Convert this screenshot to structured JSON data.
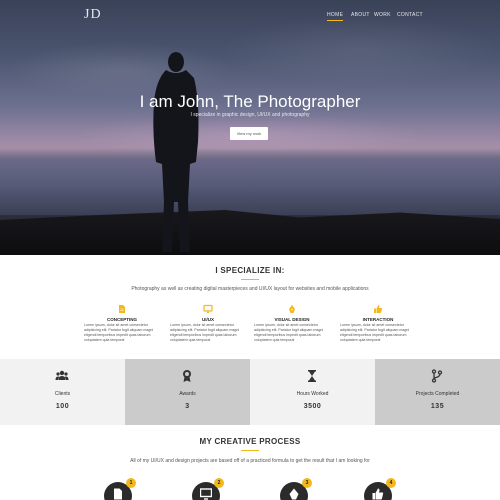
{
  "brand": {
    "logo": "JD"
  },
  "nav": {
    "items": [
      "HOME",
      "ABOUT",
      "WORK",
      "CONTACT"
    ],
    "active": "HOME"
  },
  "hero": {
    "title": "I am John, The Photographer",
    "subtitle": "I specialize in graphic design, UI/UX and photography",
    "button": "View my work"
  },
  "specialize": {
    "title": "I SPECIALIZE IN:",
    "subtitle": "Photography as well as creating digital masterpieces and UI/UX layout for websites and mobile applications",
    "items": [
      {
        "name": "CONCEPTING",
        "icon": "document-icon",
        "text": "Lorem ipsum, dolor sit amet consectetur adipisicing elit. Pariatur fugit aliquam magni eligendi temporibus impedit quas laborum voluptatem quia temporal"
      },
      {
        "name": "UI/UX",
        "icon": "monitor-icon",
        "text": "Lorem ipsum, dolor sit amet consectetur adipisicing elit. Pariatur fugit aliquam magni eligendi temporibus impedit quas laborum voluptatem quia temporal"
      },
      {
        "name": "VISUAL DESIGN",
        "icon": "pen-icon",
        "text": "Lorem ipsum, dolor sit amet consectetur adipisicing elit. Pariatur fugit aliquam magni eligendi temporibus impedit quas laborum voluptatem quia temporal"
      },
      {
        "name": "INTERACTION",
        "icon": "thumbs-up-icon",
        "text": "Lorem ipsum, dolor sit amet consectetur adipisicing elit. Pariatur fugit aliquam magni eligendi temporibus impedit quas laborum voluptatem quia temporal"
      }
    ]
  },
  "stats": [
    {
      "label": "Clients",
      "value": "100",
      "icon": "users-icon"
    },
    {
      "label": "Awards",
      "value": "3",
      "icon": "award-icon"
    },
    {
      "label": "Hours Worked",
      "value": "3500",
      "icon": "hourglass-icon"
    },
    {
      "label": "Projects Completed",
      "value": "135",
      "icon": "code-branch-icon"
    }
  ],
  "process": {
    "title": "MY CREATIVE PROCESS",
    "subtitle": "All of my UI/UX and design projects are based off of a practiced formula to get the result that I am looking for",
    "steps": [
      {
        "badge": "1",
        "icon": "document-icon"
      },
      {
        "badge": "2",
        "icon": "monitor-icon"
      },
      {
        "badge": "3",
        "icon": "pen-icon"
      },
      {
        "badge": "4",
        "icon": "thumbs-up-icon"
      }
    ]
  },
  "colors": {
    "accent": "#f5b81c",
    "dark": "#2b2b2b",
    "stat_light": "#f2f2f2",
    "stat_dark": "#cbcbcb"
  }
}
